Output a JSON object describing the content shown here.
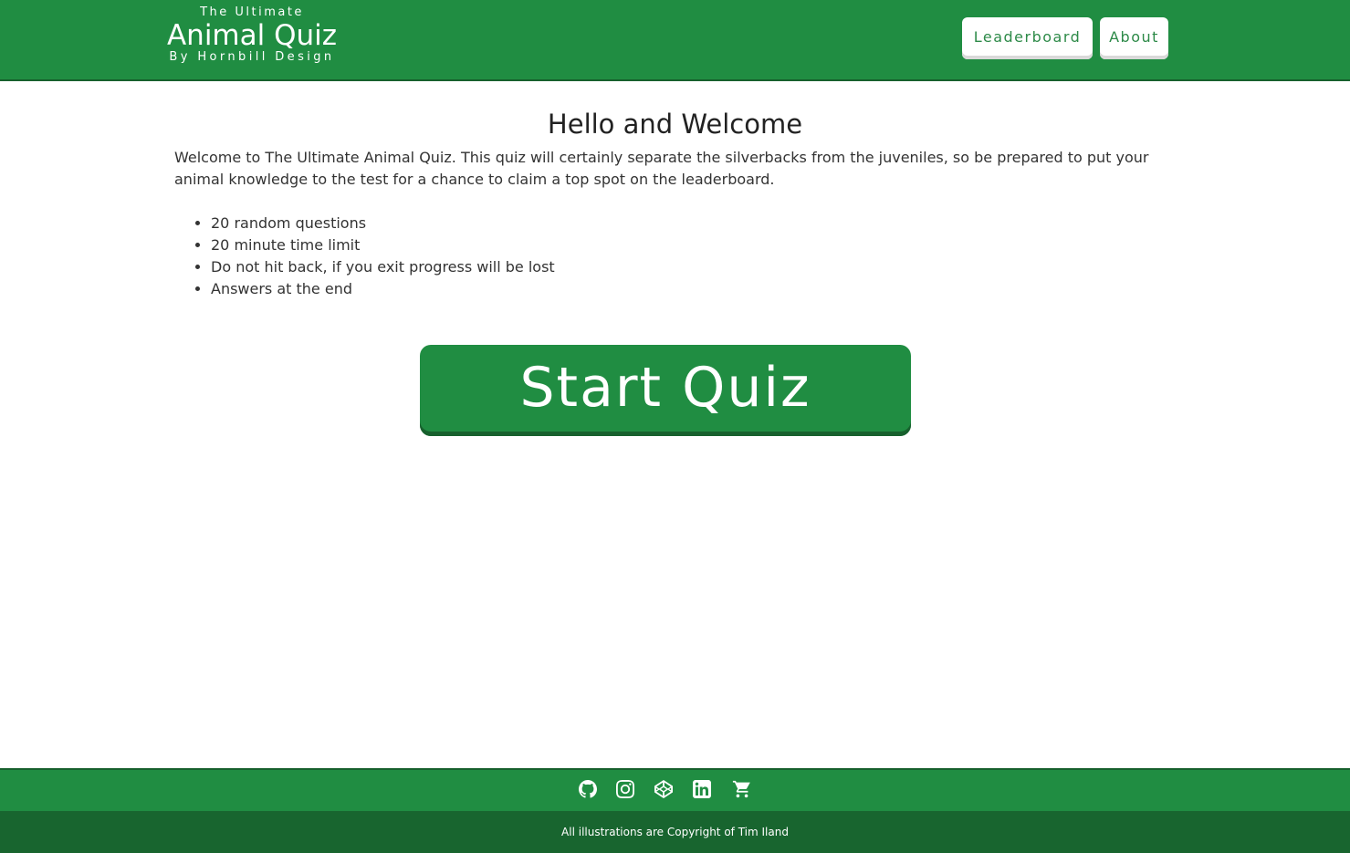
{
  "header": {
    "logo_top": "The Ultimate",
    "logo_main": "Animal Quiz",
    "logo_sub": "By Hornbill Design",
    "nav": {
      "leaderboard": "Leaderboard",
      "about": "About"
    }
  },
  "main": {
    "title": "Hello and Welcome",
    "intro": "Welcome to The Ultimate Animal Quiz. This quiz will certainly separate the silverbacks from the juveniles, so be prepared to put your animal knowledge to the test for a chance to claim a top spot on the leaderboard.",
    "rules": [
      "20 random questions",
      "20 minute time limit",
      "Do not hit back, if you exit progress will be lost",
      "Answers at the end"
    ],
    "start_button": "Start Quiz"
  },
  "footer": {
    "icons": [
      "github-icon",
      "instagram-icon",
      "codepen-icon",
      "linkedin-icon",
      "shopping-cart-icon"
    ],
    "copyright": "All illustrations are Copyright of Tim Iland"
  },
  "colors": {
    "primary_green": "#208d42",
    "dark_green": "#18652f",
    "white": "#ffffff"
  }
}
